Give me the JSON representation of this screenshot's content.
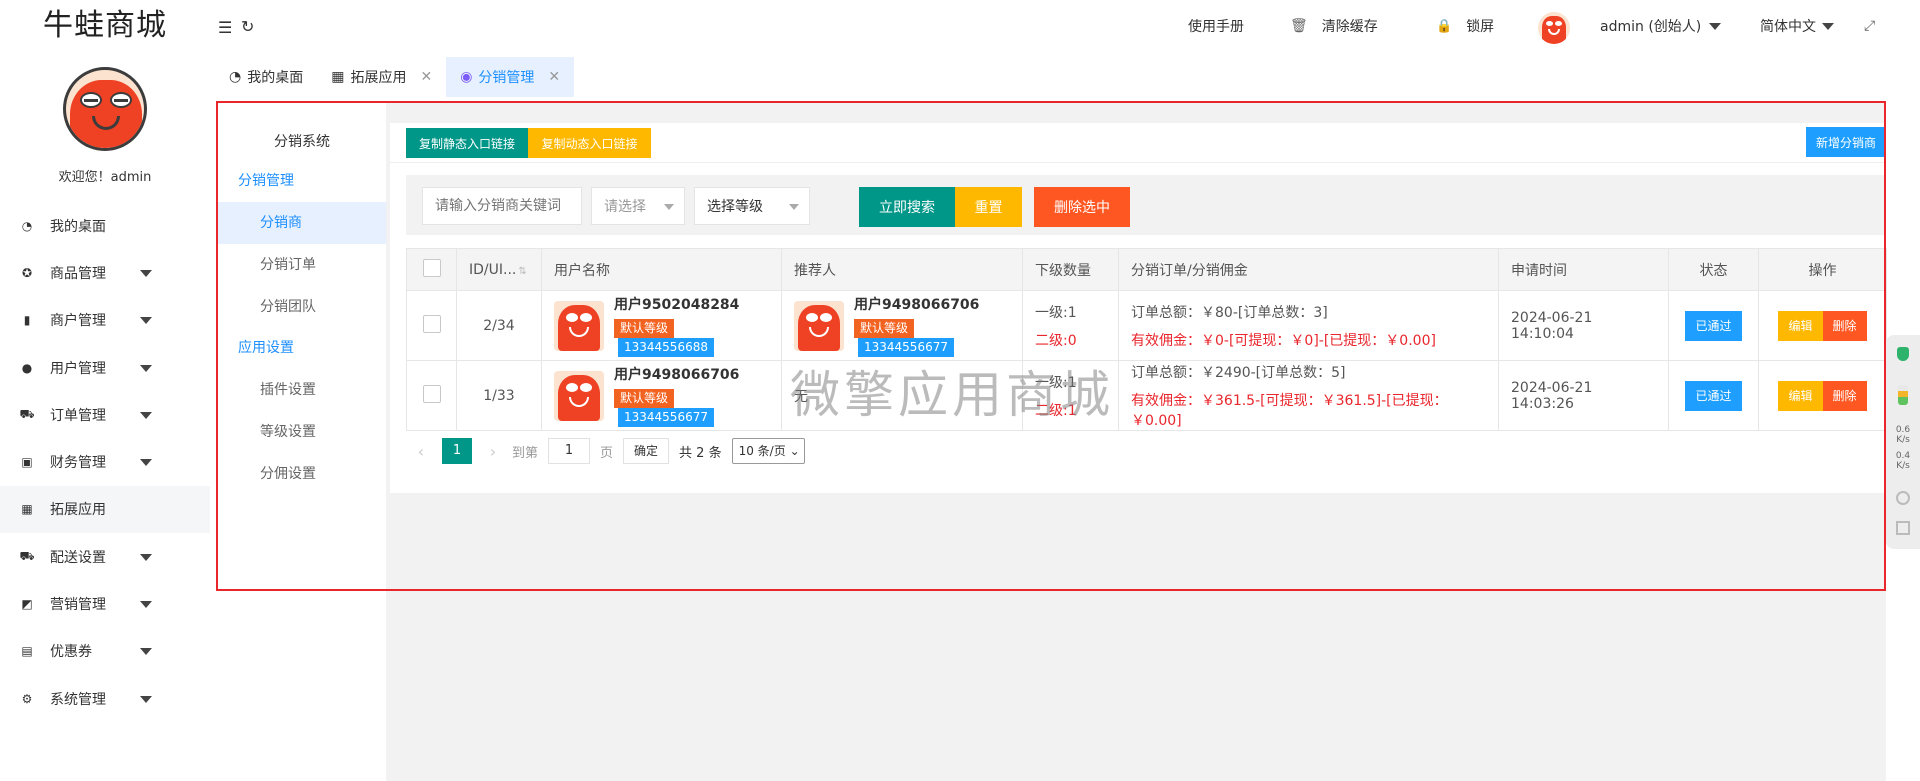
{
  "app": {
    "title": "牛蛙商城"
  },
  "header": {
    "manual": "使用手册",
    "clear_cache": "清除缓存",
    "lock": "锁屏",
    "user": "admin (创始人)",
    "language": "简体中文"
  },
  "sidebar": {
    "welcome": "欢迎您！admin",
    "items": [
      {
        "label": "我的桌面",
        "icon": "dashboard-icon"
      },
      {
        "label": "商品管理",
        "icon": "product-icon"
      },
      {
        "label": "商户管理",
        "icon": "merchant-icon"
      },
      {
        "label": "用户管理",
        "icon": "user-icon"
      },
      {
        "label": "订单管理",
        "icon": "cart-icon"
      },
      {
        "label": "财务管理",
        "icon": "money-icon"
      },
      {
        "label": "拓展应用",
        "icon": "grid-icon"
      },
      {
        "label": "配送设置",
        "icon": "truck-icon"
      },
      {
        "label": "营销管理",
        "icon": "marketing-icon"
      },
      {
        "label": "优惠券",
        "icon": "coupon-icon"
      },
      {
        "label": "系统管理",
        "icon": "gear-icon"
      }
    ]
  },
  "tabs": [
    {
      "label": "我的桌面"
    },
    {
      "label": "拓展应用"
    },
    {
      "label": "分销管理"
    }
  ],
  "submenu": {
    "title": "分销系统",
    "group1": "分销管理",
    "items1": [
      "分销商",
      "分销订单",
      "分销团队"
    ],
    "group2": "应用设置",
    "items2": [
      "插件设置",
      "等级设置",
      "分佣设置"
    ]
  },
  "toolbar": {
    "copy_static": "复制静态入口链接",
    "copy_dynamic": "复制动态入口链接",
    "add": "新增分销商"
  },
  "search": {
    "placeholder": "请输入分销商关键词",
    "select1": "请选择",
    "select2": "选择等级",
    "search_btn": "立即搜索",
    "reset_btn": "重置",
    "delete_btn": "删除选中"
  },
  "table": {
    "headers": [
      "ID/UI...",
      "用户名称",
      "推荐人",
      "下级数量",
      "分销订单/分销佣金",
      "申请时间",
      "状态",
      "操作"
    ],
    "rows": [
      {
        "id": "2/34",
        "user": "用户9502048284",
        "user_level": "默认等级",
        "user_phone": "13344556688",
        "ref": "用户9498066706",
        "ref_level": "默认等级",
        "ref_phone": "13344556677",
        "lv1": "一级:1",
        "lv2": "二级:0",
        "orders": "订单总额：￥80-[订单总数：3]",
        "commission": "有效佣金：￥0-[可提现：￥0]-[已提现：￥0.00]",
        "time": "2024-06-21 14:10:04",
        "status": "已通过",
        "edit": "编辑",
        "del": "删除"
      },
      {
        "id": "1/33",
        "user": "用户9498066706",
        "user_level": "默认等级",
        "user_phone": "13344556677",
        "ref": "无",
        "lv1": "一级:1",
        "lv2": "二级:1",
        "orders": "订单总额：￥2490-[订单总数：5]",
        "commission": "有效佣金：￥361.5-[可提现：￥361.5]-[已提现：￥0.00]",
        "time": "2024-06-21 14:03:26",
        "status": "已通过",
        "edit": "编辑",
        "del": "删除"
      }
    ]
  },
  "pager": {
    "current": "1",
    "goto_label": "到第",
    "goto_value": "1",
    "page_unit": "页",
    "confirm": "确定",
    "total": "共 2 条",
    "per_page": "10 条/页"
  },
  "watermark": "微擎应用商城",
  "widget": {
    "net1": "0.6",
    "net1_unit": "K/s",
    "net2": "0.4",
    "net2_unit": "K/s"
  },
  "colors": {
    "accent": "#1e90ff",
    "teal": "#009688",
    "orange": "#ffb800",
    "red": "#ff5722",
    "blue": "#1e9fff"
  }
}
